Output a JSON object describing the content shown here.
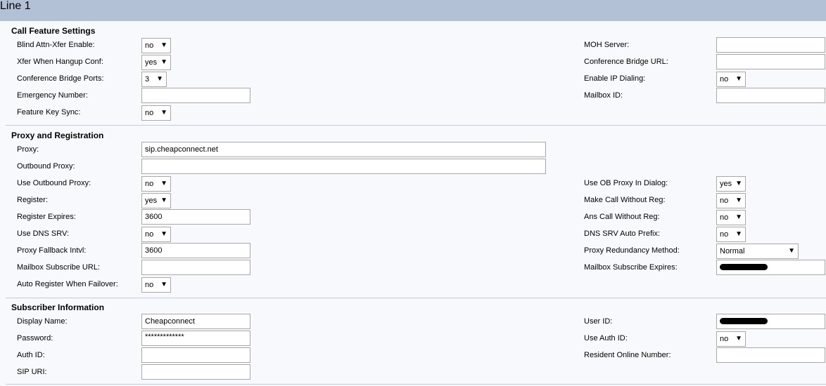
{
  "title": "Line 1",
  "call_feature": {
    "heading": "Call Feature Settings",
    "blind_attn_xfer": {
      "label": "Blind Attn-Xfer Enable:",
      "value": "no"
    },
    "xfer_hangup_conf": {
      "label": "Xfer When Hangup Conf:",
      "value": "yes"
    },
    "conf_bridge_ports": {
      "label": "Conference Bridge Ports:",
      "value": "3"
    },
    "emergency_number": {
      "label": "Emergency Number:",
      "value": ""
    },
    "feature_key_sync": {
      "label": "Feature Key Sync:",
      "value": "no"
    },
    "moh_server": {
      "label": "MOH Server:",
      "value": ""
    },
    "conf_bridge_url": {
      "label": "Conference Bridge URL:",
      "value": ""
    },
    "enable_ip_dialing": {
      "label": "Enable IP Dialing:",
      "value": "no"
    },
    "mailbox_id": {
      "label": "Mailbox ID:",
      "value": ""
    }
  },
  "proxy": {
    "heading": "Proxy and Registration",
    "proxy": {
      "label": "Proxy:",
      "value": "sip.cheapconnect.net"
    },
    "outbound_proxy": {
      "label": "Outbound Proxy:",
      "value": ""
    },
    "use_outbound_proxy": {
      "label": "Use Outbound Proxy:",
      "value": "no"
    },
    "register": {
      "label": "Register:",
      "value": "yes"
    },
    "register_expires": {
      "label": "Register Expires:",
      "value": "3600"
    },
    "use_dns_srv": {
      "label": "Use DNS SRV:",
      "value": "no"
    },
    "proxy_fallback": {
      "label": "Proxy Fallback Intvl:",
      "value": "3600"
    },
    "mailbox_subscribe_url": {
      "label": "Mailbox Subscribe URL:",
      "value": ""
    },
    "auto_register_failover": {
      "label": "Auto Register When Failover:",
      "value": "no"
    },
    "use_ob_proxy_dialog": {
      "label": "Use OB Proxy In Dialog:",
      "value": "yes"
    },
    "make_call_without_reg": {
      "label": "Make Call Without Reg:",
      "value": "no"
    },
    "ans_call_without_reg": {
      "label": "Ans Call Without Reg:",
      "value": "no"
    },
    "dns_srv_auto_prefix": {
      "label": "DNS SRV Auto Prefix:",
      "value": "no"
    },
    "proxy_redundancy": {
      "label": "Proxy Redundancy Method:",
      "value": "Normal"
    },
    "mailbox_subscribe_expires": {
      "label": "Mailbox Subscribe Expires:"
    }
  },
  "subscriber": {
    "heading": "Subscriber Information",
    "display_name": {
      "label": "Display Name:",
      "value": "Cheapconnect"
    },
    "password": {
      "label": "Password:",
      "value": "*************"
    },
    "auth_id": {
      "label": "Auth ID:",
      "value": ""
    },
    "sip_uri": {
      "label": "SIP URI:",
      "value": ""
    },
    "user_id": {
      "label": "User ID:"
    },
    "use_auth_id": {
      "label": "Use Auth ID:",
      "value": "no"
    },
    "resident_online_number": {
      "label": "Resident Online Number:",
      "value": ""
    }
  },
  "icons": {
    "dropdown": "chevron-down-icon"
  }
}
